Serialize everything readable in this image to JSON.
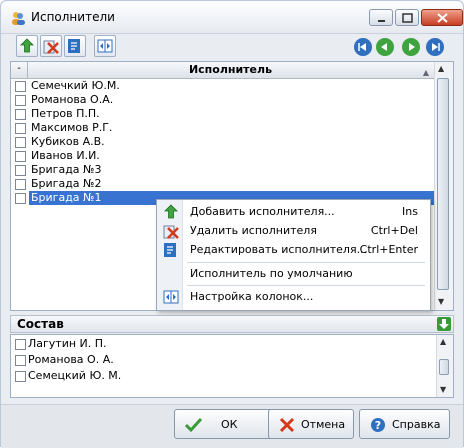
{
  "window": {
    "title": "Исполнители"
  },
  "grid": {
    "header_selector": "-",
    "column_title": "Исполнитель",
    "rows": [
      "Семечкий Ю.М.",
      "Романова О.А.",
      "Петров П.П.",
      "Максимов Р.Г.",
      "Кубиков А.В.",
      "Иванов И.И.",
      "Бригада №3",
      "Бригада №2",
      "Бригада №1"
    ],
    "selected_index": 8
  },
  "context_menu": {
    "items": [
      {
        "label": "Добавить исполнителя...",
        "shortcut": "Ins",
        "icon": "add-arrow-icon"
      },
      {
        "label": "Удалить исполнителя",
        "shortcut": "Ctrl+Del",
        "icon": "delete-icon"
      },
      {
        "label": "Редактировать исполнителя...",
        "shortcut": "Ctrl+Enter",
        "icon": "edit-icon"
      },
      {
        "label": "Исполнитель по умолчанию",
        "shortcut": ""
      },
      {
        "label": "Настройка колонок...",
        "shortcut": "",
        "icon": "columns-icon"
      }
    ]
  },
  "composition": {
    "label": "Состав",
    "rows": [
      "Лагутин И. П.",
      "Романова О. А.",
      "Семецкий Ю. М."
    ]
  },
  "footer": {
    "ok_label": "ОК",
    "cancel_label": "Отмена",
    "help_label": "Справка"
  },
  "colors": {
    "selection": "#3873d1",
    "ok_green": "#3a9a3a",
    "cancel_red": "#d4391c",
    "nav_blue": "#2f6fc0",
    "nav_green": "#3fa33f"
  }
}
